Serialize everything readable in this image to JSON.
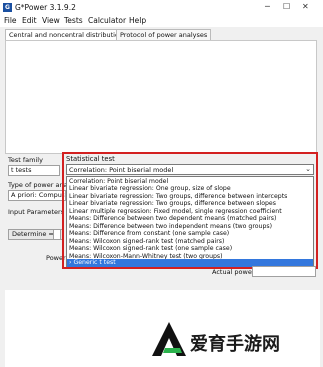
{
  "window": {
    "title": "G*Power 3.1.9.2",
    "icon_text": "G"
  },
  "menu": [
    "File",
    "Edit",
    "View",
    "Tests",
    "Calculator",
    "Help"
  ],
  "tabs": [
    "Central and noncentral distributions",
    "Protocol of power analyses"
  ],
  "left": {
    "test_family_label": "Test family",
    "test_family_value": "t tests",
    "analysis_label": "Type of power analysis",
    "analysis_value": "A priori: Compute",
    "input_params_label": "Input Parameters",
    "determine_button": "Determine =>",
    "power_label": "Power"
  },
  "statistical_test": {
    "label": "Statistical test",
    "selected": "Correlation: Point biserial model",
    "options": [
      "Correlation: Point biserial model",
      "Linear bivariate regression: One group, size of slope",
      "Linear bivariate regression: Two groups, difference between intercepts",
      "Linear bivariate regression: Two groups, difference between slopes",
      "Linear multiple regression: Fixed model, single regression coefficient",
      "Means: Difference between two dependent means (matched pairs)",
      "Means: Difference between two independent means (two groups)",
      "Means: Difference from constant (one sample case)",
      "Means: Wilcoxon signed-rank test (matched pairs)",
      "Means: Wilcoxon signed-rank test (one sample case)",
      "Means: Wilcoxon-Mann-Whitney test (two groups)",
      "Generic t test"
    ],
    "highlighted_index": 11
  },
  "output": {
    "actual_power_label": "Actual power"
  },
  "watermark": {
    "text": "爱育手游网"
  },
  "colors": {
    "highlight_border": "#d32020",
    "selection": "#3377dd"
  }
}
